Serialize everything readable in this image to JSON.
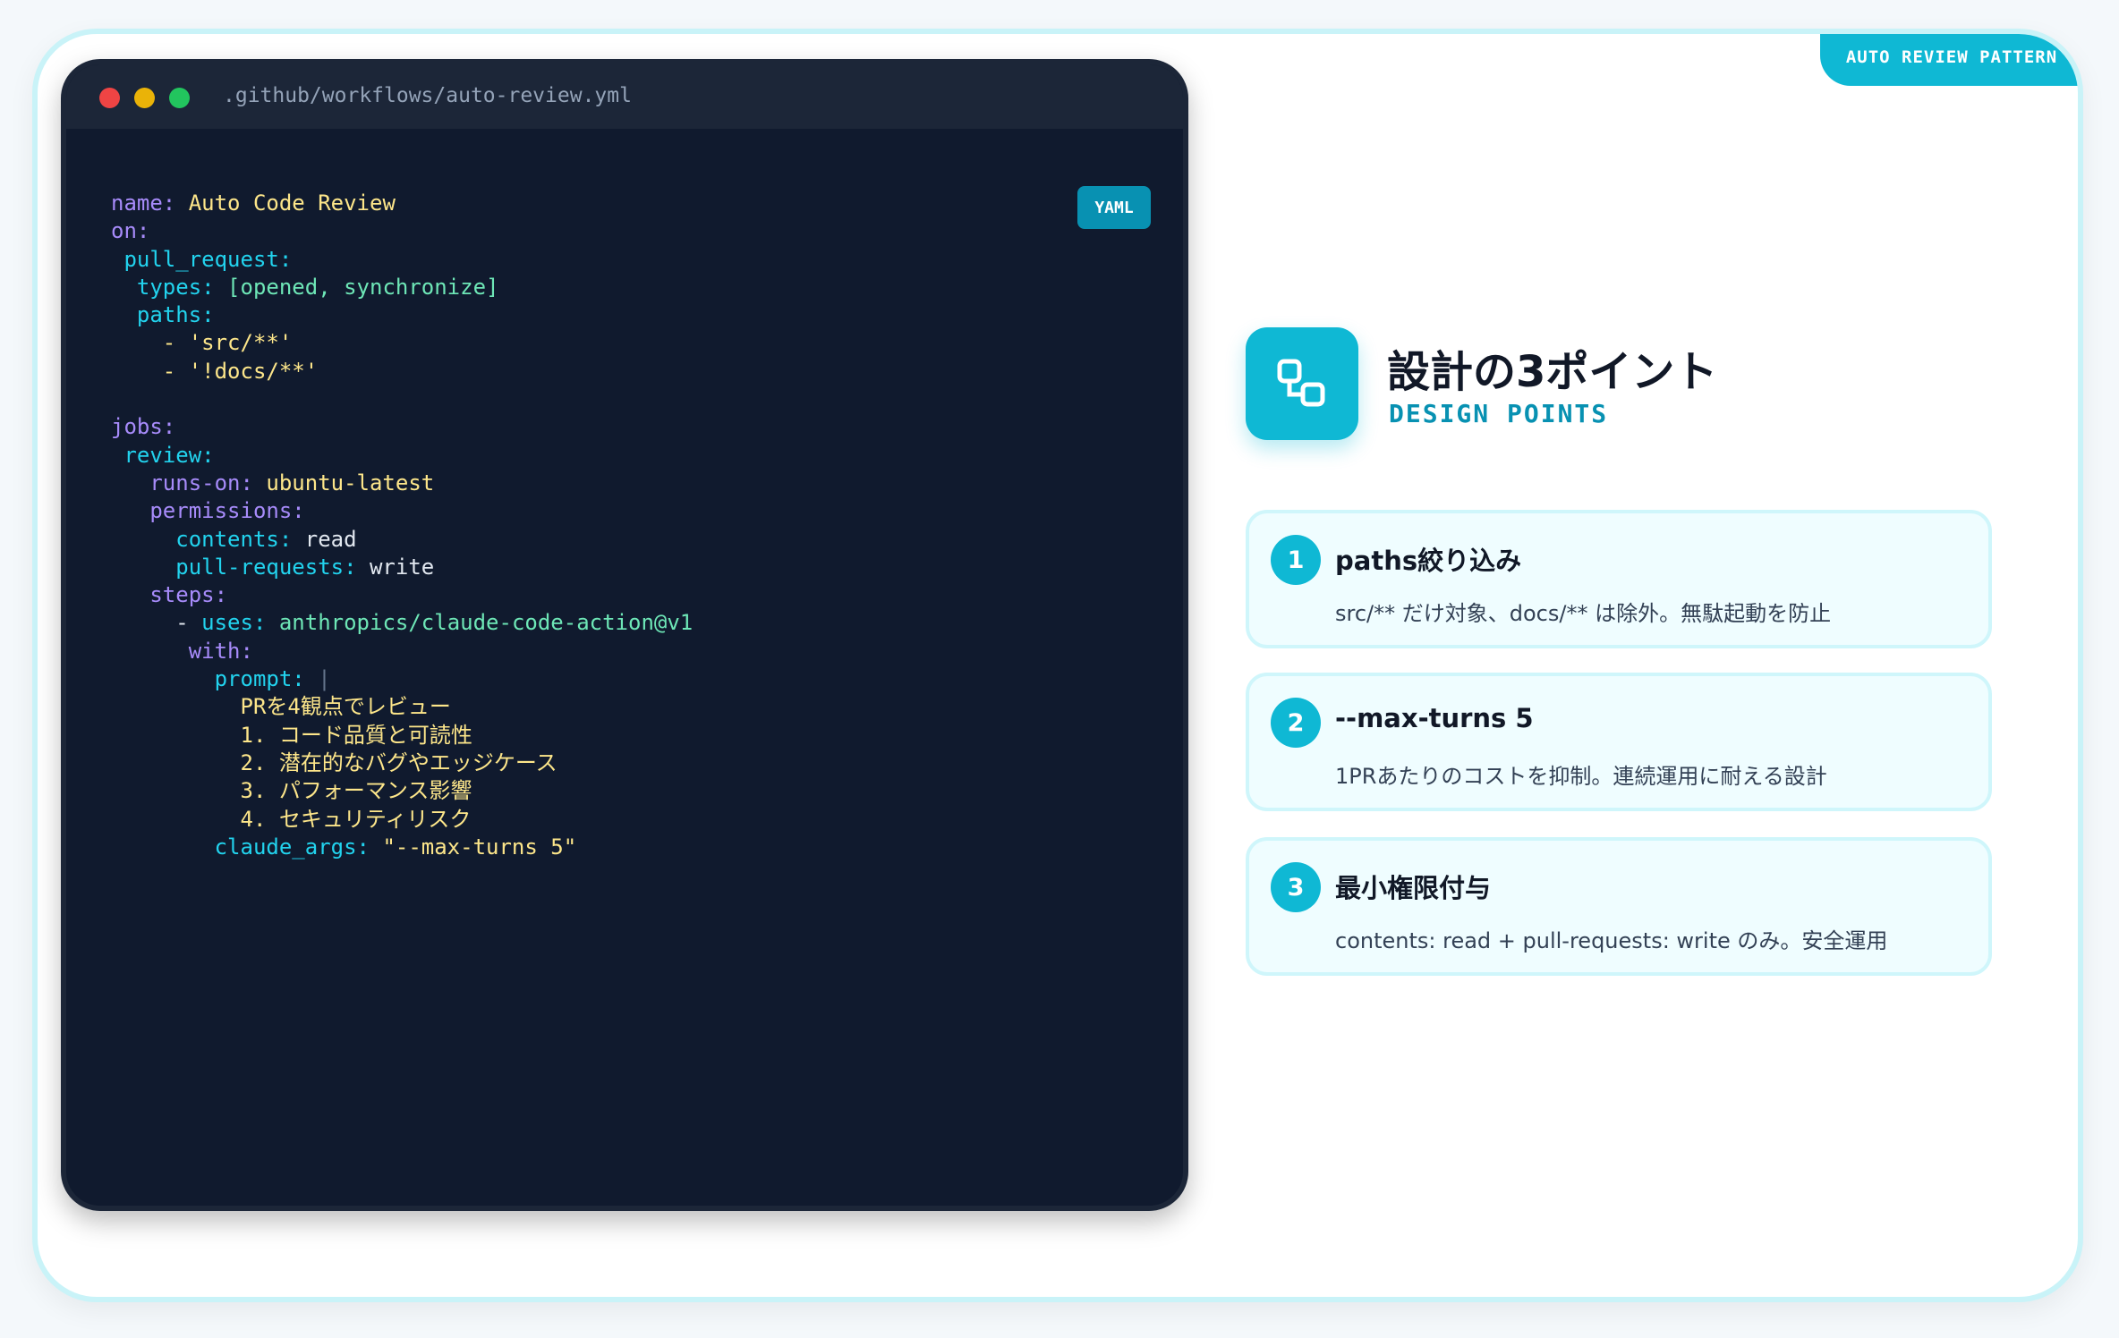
{
  "tag": "AUTO REVIEW PATTERN",
  "editor": {
    "filename": ".github/workflows/auto-review.yml",
    "language_badge": "YAML",
    "lines": [
      [
        {
          "t": "name: ",
          "c": "k1"
        },
        {
          "t": "Auto Code Review",
          "c": "vy"
        }
      ],
      [
        {
          "t": "on:",
          "c": "k1"
        }
      ],
      [
        {
          "t": " pull_request:",
          "c": "k2"
        }
      ],
      [
        {
          "t": "  types: ",
          "c": "k2"
        },
        {
          "t": "[opened, synchronize]",
          "c": "vg"
        }
      ],
      [
        {
          "t": "  paths:",
          "c": "k2"
        }
      ],
      [
        {
          "t": "    - ",
          "c": "vy"
        },
        {
          "t": "'src/**'",
          "c": "vy"
        }
      ],
      [
        {
          "t": "    - ",
          "c": "vy"
        },
        {
          "t": "'!docs/**'",
          "c": "vy"
        }
      ],
      [],
      [
        {
          "t": "jobs:",
          "c": "k1"
        }
      ],
      [
        {
          "t": " review:",
          "c": "k2"
        }
      ],
      [
        {
          "t": "   runs-on: ",
          "c": "k1"
        },
        {
          "t": "ubuntu-latest",
          "c": "vy"
        }
      ],
      [
        {
          "t": "   permissions:",
          "c": "k1"
        }
      ],
      [
        {
          "t": "     contents: ",
          "c": "k2"
        },
        {
          "t": "read",
          "c": "vw"
        }
      ],
      [
        {
          "t": "     pull-requests: ",
          "c": "k2"
        },
        {
          "t": "write",
          "c": "vw"
        }
      ],
      [
        {
          "t": "   steps:",
          "c": "k1"
        }
      ],
      [
        {
          "t": "     - ",
          "c": "vw"
        },
        {
          "t": "uses: ",
          "c": "k2"
        },
        {
          "t": "anthropics/claude-code-action@v1",
          "c": "vg"
        }
      ],
      [
        {
          "t": "      with:",
          "c": "k1"
        }
      ],
      [
        {
          "t": "        prompt: ",
          "c": "k2"
        },
        {
          "t": "|",
          "c": "pipe"
        }
      ],
      [
        {
          "t": "          PRを4観点でレビュー",
          "c": "vy"
        }
      ],
      [
        {
          "t": "          1. コード品質と可読性",
          "c": "vy"
        }
      ],
      [
        {
          "t": "          2. 潜在的なバグやエッジケース",
          "c": "vy"
        }
      ],
      [
        {
          "t": "          3. パフォーマンス影響",
          "c": "vy"
        }
      ],
      [
        {
          "t": "          4. セキュリティリスク",
          "c": "vy"
        }
      ],
      [
        {
          "t": "        claude_args: ",
          "c": "k2"
        },
        {
          "t": "\"--max-turns 5\"",
          "c": "vy"
        }
      ]
    ]
  },
  "header": {
    "title": "設計の3ポイント",
    "subtitle": "DESIGN POINTS",
    "icon": "workflow-nodes-icon"
  },
  "points": [
    {
      "num": "1",
      "title": "paths絞り込み",
      "desc": "src/** だけ対象、docs/** は除外。無駄起動を防止"
    },
    {
      "num": "2",
      "title": "--max-turns 5",
      "desc": "1PRあたりのコストを抑制。連続運用に耐える設計"
    },
    {
      "num": "3",
      "title": "最小権限付与",
      "desc": "contents: read + pull-requests: write のみ。安全運用"
    }
  ],
  "colors": {
    "accent": "#0fb8d4",
    "code_bg": "#101a2e",
    "key_purple": "#a78bfa",
    "key_cyan": "#22d3ee",
    "value_yellow": "#fde68a",
    "value_green": "#6ee7b7"
  }
}
